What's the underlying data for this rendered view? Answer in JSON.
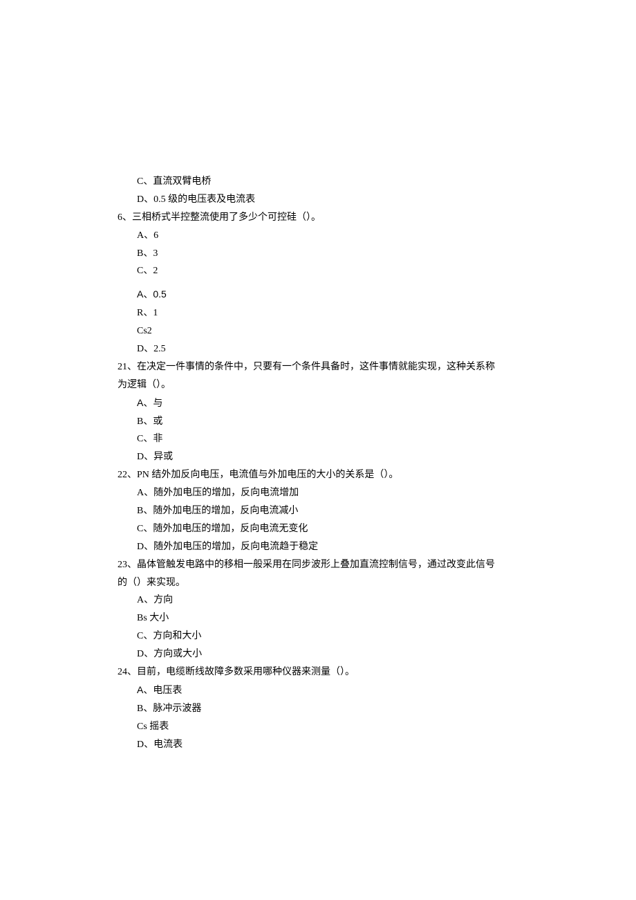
{
  "q5_tail": {
    "options": [
      "C、直流双臂电桥",
      "D、0.5 级的电压表及电流表"
    ]
  },
  "q6": {
    "text": "6、三相桥式半控整流使用了多少个可控硅（）。",
    "options": [
      "A、6",
      "B、3",
      "C、2"
    ]
  },
  "q_extra": {
    "options": [
      "A、0.5",
      "R、1",
      "Cs2",
      "D、2.5"
    ]
  },
  "q21": {
    "text_line1": "21、在决定一件事情的条件中，只要有一个条件具备时，这件事情就能实现，这种关系称",
    "text_line2": "为逻辑（）。",
    "options": [
      "A、与",
      "B、或",
      "C、非",
      "D、异或"
    ]
  },
  "q22": {
    "text": "22、PN 结外加反向电压，电流值与外加电压的大小的关系是（）。",
    "options": [
      "A、随外加电压的增加，反向电流增加",
      "B、随外加电压的增加，反向电流减小",
      "C、随外加电压的增加，反向电流无变化",
      "D、随外加电压的增加，反向电流趋于稳定"
    ]
  },
  "q23": {
    "text_line1": "23、晶体管触发电路中的移相一般采用在同步波形上叠加直流控制信号，通过改变此信号",
    "text_line2": "的（）来实现。",
    "options": [
      "A、方向",
      "Bs 大小",
      "C、方向和大小",
      "D、方向或大小"
    ]
  },
  "q24": {
    "text": "24、目前，电缆断线故障多数采用哪种仪器来测量（）。",
    "options": [
      "A、电压表",
      "B、脉冲示波器",
      "Cs 摇表",
      "D、电流表"
    ]
  }
}
